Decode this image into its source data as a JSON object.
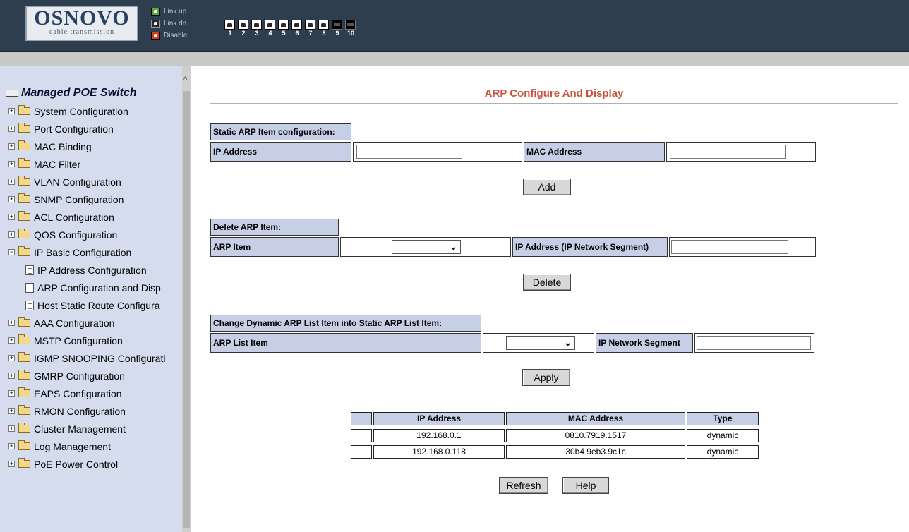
{
  "header": {
    "brand": "OSNOVO",
    "tagline": "cable transmission",
    "legend": [
      {
        "label": "Link up",
        "color": "#4fae3a"
      },
      {
        "label": "Link dn",
        "color": "#2a2a2a"
      },
      {
        "label": "Disable",
        "color": "#d43c1c"
      }
    ],
    "ports": [
      "1",
      "2",
      "3",
      "4",
      "5",
      "6",
      "7",
      "8",
      "9",
      "10"
    ]
  },
  "sidebar": {
    "root": "Managed POE Switch",
    "items": [
      "System Configuration",
      "Port Configuration",
      "MAC Binding",
      "MAC Filter",
      "VLAN Configuration",
      "SNMP Configuration",
      "ACL Configuration",
      "QOS Configuration",
      "IP Basic Configuration",
      "IP Address Configuration",
      "ARP Configuration and Disp",
      "Host Static Route Configura",
      "AAA Configuration",
      "MSTP Configuration",
      "IGMP SNOOPING Configurati",
      "GMRP Configuration",
      "EAPS Configuration",
      "RMON Configuration",
      "Cluster Management",
      "Log Management",
      "PoE Power Control"
    ]
  },
  "main": {
    "title": "ARP Configure And Display",
    "static_section": {
      "header": "Static ARP Item configuration:",
      "ip_label": "IP Address",
      "mac_label": "MAC Address",
      "add_button": "Add"
    },
    "delete_section": {
      "header": "Delete ARP Item:",
      "arp_item_label": "ARP Item",
      "segment_label": "IP Address (IP Network Segment)",
      "delete_button": "Delete"
    },
    "change_section": {
      "header": "Change Dynamic ARP List Item into Static ARP List Item:",
      "list_item_label": "ARP List Item",
      "segment_label": "IP Network Segment",
      "apply_button": "Apply"
    },
    "table": {
      "columns": [
        "IP Address",
        "MAC Address",
        "Type"
      ],
      "rows": [
        {
          "ip": "192.168.0.1",
          "mac": "0810.7919.1517",
          "type": "dynamic"
        },
        {
          "ip": "192.168.0.118",
          "mac": "30b4.9eb3.9c1c",
          "type": "dynamic"
        }
      ]
    },
    "refresh_button": "Refresh",
    "help_button": "Help"
  }
}
